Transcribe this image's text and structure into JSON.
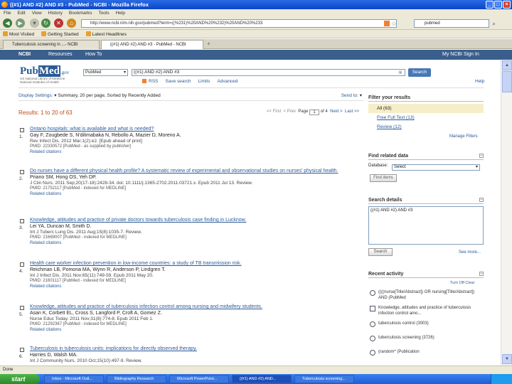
{
  "window": {
    "title": "((#1) AND #2) AND #3 - PubMed - NCBI - Mozilla Firefox"
  },
  "menu": [
    "File",
    "Edit",
    "View",
    "History",
    "Bookmarks",
    "Tools",
    "Help"
  ],
  "nav": {
    "url": "http://www.ncbi.nlm.nih.gov/pubmed?term=((%231)%20AND%20%232)%20AND%20%233",
    "search_placeholder": "pubmed"
  },
  "bookmarks": [
    "Most Visited",
    "Getting Started",
    "Latest Headlines"
  ],
  "tabs": [
    "Tuberculosis screening in ...- NCBI",
    "((#1) AND #2) AND #3 - PubMed - NCBI"
  ],
  "ncbi": {
    "logo": "NCBI",
    "resources": "Resources",
    "howto": "How To",
    "myncbi": "My NCBI Sign In"
  },
  "pubmed": {
    "logo_a": "Pub",
    "logo_b": "Med",
    "logo_c": ".gov",
    "subtitle": "US National Library of Medicine National Institutes of Health",
    "db": "PubMed",
    "query": "((#1) AND #2) AND #3",
    "search_btn": "Search",
    "help": "Help",
    "links": [
      "RSS",
      "Save search",
      "Limits",
      "Advanced"
    ]
  },
  "display": {
    "settings": "Display Settings:",
    "settings_value": "Summary, 20 per page, Sorted by Recently Added",
    "sendto": "Send to:",
    "results": "Results: 1 to 20 of 63",
    "first": "<< First",
    "prev": "< Prev",
    "page_label": "Page",
    "page": "1",
    "of": "of 4",
    "next": "Next >",
    "last": "Last >>"
  },
  "results": [
    {
      "num": "1.",
      "title": "Ontario hospitals: what is available and what is needed?",
      "authors": "Gay F, Zougbede S, N'dilimabaka N, Rebollo A, Mazier D, Moreno A.",
      "journal": "Rev Infect Dis. 2012 Mar;1(2):e2. [Epub ahead of print]",
      "pmid": "PMID: 22330572 [PubMed - as supplied by publisher]",
      "related": "Related citations"
    },
    {
      "num": "2.",
      "title": "Do nurses have a different physical health profile? A systematic review of experimental and observational studies on nurses' physical health.",
      "authors": "Priano SM, Hong OS, Yeh DP.",
      "journal": "J Clin Nurs. 2011 Sep;20(17-18):2428-34. doi: 10.1111/j.1365-2702.2011.03721.x. Epub 2011 Jul 13. Review.",
      "pmid": "PMID: 21752117 [PubMed - indexed for MEDLINE]",
      "related": "Related citations"
    },
    {
      "num": "3.",
      "title": "Knowledge, attitudes and practice of private doctors towards tuberculosis case finding in Lucknow.",
      "authors": "Lei YA, Duncan M, Smith D.",
      "journal": "Int J Tuberc Lung Dis. 2011 Aug;15(8):1035-7. Review.",
      "pmid": "PMID: 21669007 [PubMed - indexed for MEDLINE]",
      "related": "Related citations"
    },
    {
      "num": "4.",
      "title": "Health care worker infection prevention in low-income countries: a study of TB transmission risk.",
      "authors": "Reichman LB, Pomona MA, Wynn R, Anderson P, Lindgren T.",
      "journal": "Int J Infect Dis. 2011 Nov;65(11):749-59. Epub 2011 May 20.",
      "pmid": "PMID: 21601117 [PubMed - indexed for MEDLINE]",
      "related": "Related citations"
    },
    {
      "num": "5.",
      "title": "Knowledge, attitudes and practice of tuberculosis infection control among nursing and midwifery students.",
      "authors": "Asan K, Corbett EL, Cross S, Langford P, Croft A, Gomez Z.",
      "journal": "Nurse Educ Today. 2011 Nov;31(8):774-8. Epub 2011 Feb 1.",
      "pmid": "PMID: 21292367 [PubMed - indexed for MEDLINE]",
      "related": "Related citations"
    },
    {
      "num": "6.",
      "title": "Tuberculosis in tuberculosis units: implications for directly observed therapy.",
      "authors": "Harries D, Walsh MA.",
      "journal": "Int J Community Nurs. 2010 Oct;15(10):497-9. Review.",
      "pmid": "",
      "related": ""
    }
  ],
  "filters": {
    "title": "Filter your results",
    "items": [
      "All (63)",
      "Free Full Text (13)",
      "Review (12)"
    ],
    "manage": "Manage Filters"
  },
  "related_data": {
    "title": "Find related data",
    "db_label": "Database:",
    "db_value": "Select",
    "find_btn": "Find items"
  },
  "search_details": {
    "title": "Search details",
    "text": "((#1) AND #2) AND #3",
    "search_btn": "Search",
    "see_more": "See more..."
  },
  "recent": {
    "title": "Recent activity",
    "turn_off": "Turn Off  Clear",
    "items": [
      "((((nurse[Title/Abstract]) OR nursing[Title/Abstract]) AND (PubMed",
      "Knowledge, attitudes and practice of tuberculosis infection control amo...",
      "tuberculosis control (3003)",
      "tuberculosis screening (3726)",
      "(random* (Publication"
    ]
  },
  "status": {
    "text": "Done"
  },
  "taskbar": {
    "start": "start",
    "tasks": [
      "Inbox - Microsoft Outl...",
      "Bibliography Research",
      "Microsoft PowerPoint...",
      "((#1) AND #2) AND...",
      "Tuberculosis screening..."
    ]
  }
}
